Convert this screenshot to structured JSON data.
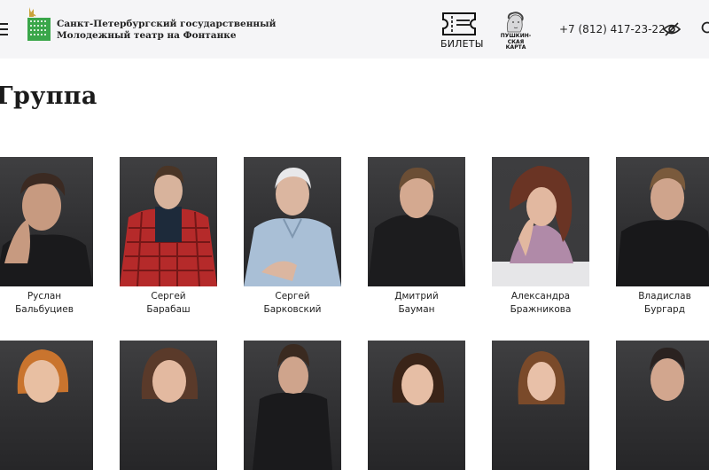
{
  "header": {
    "theatre_name_line1": "Санкт-Петербургский государственный",
    "theatre_name_line2": "Молодежный театр на Фонтанке",
    "tickets_label": "БИЛЕТЫ",
    "pushkin_card_line1": "ПУШКИН-",
    "pushkin_card_line2": "СКАЯ",
    "pushkin_card_line3": "КАРТА",
    "phone": "+7 (812) 417-23-22",
    "icons": [
      "menu-icon",
      "theatre-logo-icon",
      "ticket-icon",
      "pushkin-card-icon",
      "eye-off-icon",
      "search-icon"
    ]
  },
  "page": {
    "title": "Группа"
  },
  "colors": {
    "header_bg": "#f5f5f7",
    "logo_green": "#3aa64a",
    "logo_gold": "#c9a23a",
    "photo_bg": "#333335",
    "text": "#222222"
  },
  "actors": [
    {
      "first_name": "Руслан",
      "last_name": "Бальбуциев"
    },
    {
      "first_name": "Сергей",
      "last_name": "Барабаш"
    },
    {
      "first_name": "Сергей",
      "last_name": "Барковский"
    },
    {
      "first_name": "Дмитрий",
      "last_name": "Бауман"
    },
    {
      "first_name": "Александра",
      "last_name": "Бражникова"
    },
    {
      "first_name": "Владислав",
      "last_name": "Бургард"
    }
  ]
}
